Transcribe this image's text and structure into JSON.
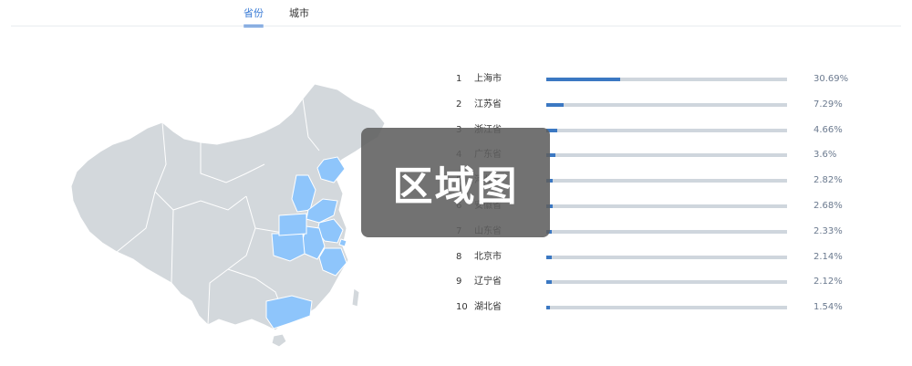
{
  "tabs": [
    {
      "label": "省份",
      "active": true
    },
    {
      "label": "城市",
      "active": false
    }
  ],
  "colors": {
    "accent": "#3a7bd5",
    "bar_fill": "#3b78c2",
    "bar_track": "#cfd6dd",
    "map_default": "#d3d8dc",
    "map_highlight": "#8ec5fb",
    "overlay_bg": "#5f5f5f"
  },
  "overlay": {
    "label": "区域图"
  },
  "ranking": [
    {
      "rank": "1",
      "name": "上海市",
      "percent": "30.69%",
      "value": 30.69
    },
    {
      "rank": "2",
      "name": "江苏省",
      "percent": "7.29%",
      "value": 7.29
    },
    {
      "rank": "3",
      "name": "浙江省",
      "percent": "4.66%",
      "value": 4.66
    },
    {
      "rank": "4",
      "name": "广东省",
      "percent": "3.6%",
      "value": 3.6
    },
    {
      "rank": "5",
      "name": "河北省",
      "percent": "2.82%",
      "value": 2.82
    },
    {
      "rank": "6",
      "name": "安徽省",
      "percent": "2.68%",
      "value": 2.68
    },
    {
      "rank": "7",
      "name": "山东省",
      "percent": "2.33%",
      "value": 2.33
    },
    {
      "rank": "8",
      "name": "北京市",
      "percent": "2.14%",
      "value": 2.14
    },
    {
      "rank": "9",
      "name": "辽宁省",
      "percent": "2.12%",
      "value": 2.12
    },
    {
      "rank": "10",
      "name": "湖北省",
      "percent": "1.54%",
      "value": 1.54
    }
  ],
  "bar_max_percent": 100
}
